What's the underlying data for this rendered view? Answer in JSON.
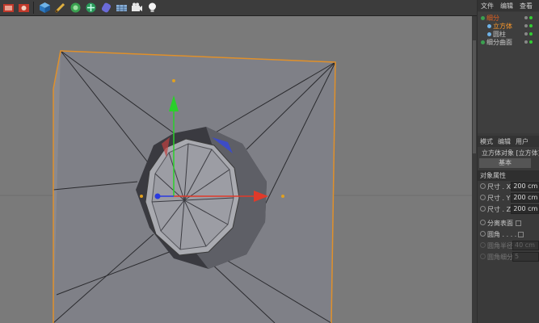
{
  "toolbar": {
    "icons": [
      "render-icon",
      "picture-viewer-icon",
      "cube-icon",
      "pen-icon",
      "subdivision-icon",
      "array-icon",
      "deformer-icon",
      "floor-icon",
      "camera-icon",
      "light-icon"
    ]
  },
  "menu": [
    "文件",
    "编辑",
    "查看"
  ],
  "objects": [
    {
      "name": "细分",
      "color": "#e06020"
    },
    {
      "name": "立方体",
      "color": "#ff9a2a"
    },
    {
      "name": "圆柱",
      "color": "#cfcfcf"
    },
    {
      "name": "细分曲面",
      "color": "#cfcfcf"
    }
  ],
  "attributes": {
    "menu": [
      "模式",
      "编辑",
      "用户"
    ],
    "title": "立方体对象 [立方体]",
    "tab_basic": "基本",
    "section": "对象属性",
    "fields": [
      {
        "label": "尺寸 . X",
        "value": "200 cm"
      },
      {
        "label": "尺寸 . Y",
        "value": "200 cm"
      },
      {
        "label": "尺寸 . Z",
        "value": "200 cm"
      }
    ],
    "separate": "分离表面",
    "fillet": "圆角",
    "fillet_radius": {
      "label": "圆角半径",
      "value": "40 cm"
    },
    "fillet_subdiv": {
      "label": "圆角细分",
      "value": "5"
    }
  },
  "colors": {
    "viewport_bg": "#7a7a7a",
    "mesh_face": "#7f8087",
    "selection_outline": "#e0902a",
    "axis_x": "#e03a2a",
    "axis_y": "#2ad02a",
    "axis_z": "#2a3ae0"
  }
}
